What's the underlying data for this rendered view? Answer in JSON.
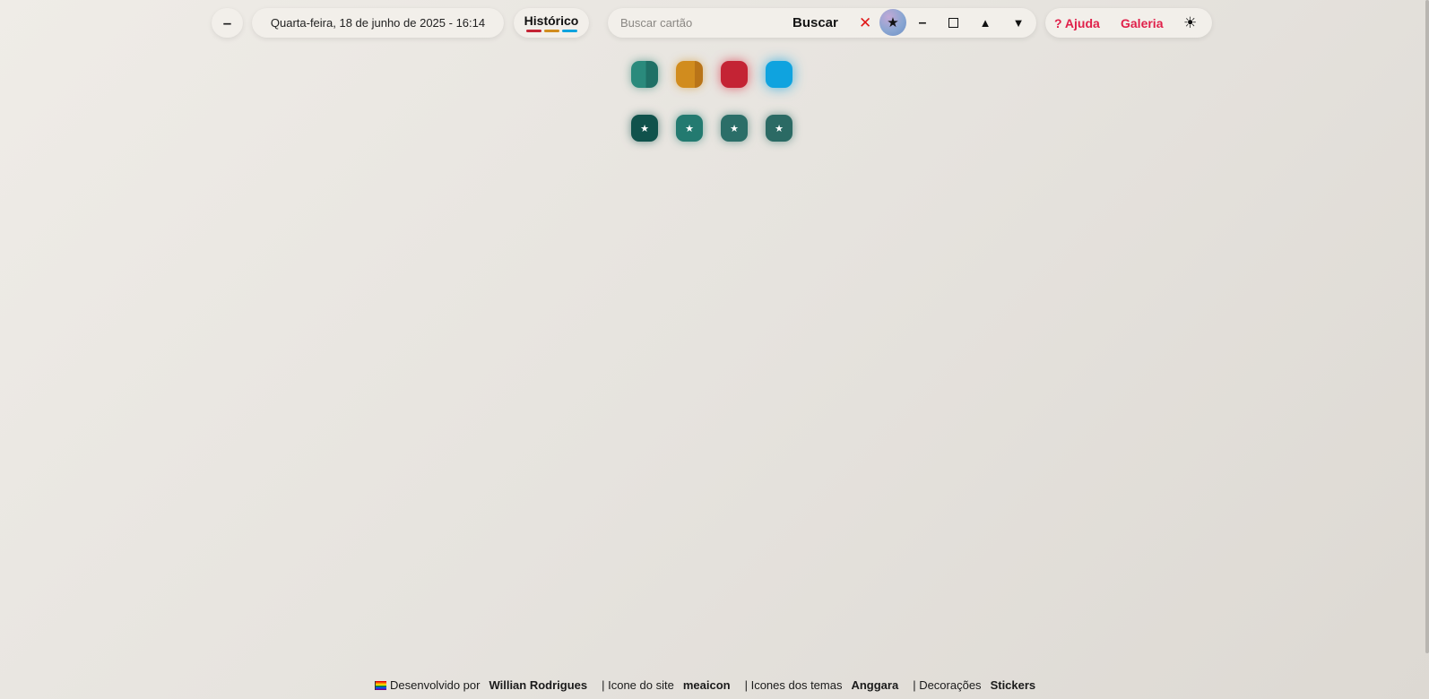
{
  "toolbar": {
    "collapse_label": "–",
    "date_time": "Quarta-feira, 18 de junho de 2025 - 16:14",
    "history_label": "Histórico",
    "history_colors": [
      "#c42334",
      "#d18c1e",
      "#0fa3df"
    ],
    "search": {
      "placeholder": "Buscar cartão",
      "value": "",
      "button_label": "Buscar",
      "clear_label": "✕"
    },
    "star_label": "★",
    "minimize_label": "–",
    "up_label": "▲",
    "down_label": "▼",
    "help_label": "? Ajuda",
    "gallery_label": "Galeria",
    "theme_label": "☀"
  },
  "theme_tiles": [
    {
      "name": "teal",
      "color": "#2a8a7c"
    },
    {
      "name": "amber",
      "color": "#d18c1e"
    },
    {
      "name": "red",
      "color": "#c42334"
    },
    {
      "name": "blue",
      "color": "#0fa3df"
    }
  ],
  "favorite_tiles": {
    "icon": "star-icon",
    "symbol": "★",
    "colors": [
      "#10524c",
      "#237a70",
      "#2b6e68",
      "#2b6a64"
    ]
  },
  "footer": {
    "developed_by_label": "Desenvolvido por",
    "developer": "Willian Rodrigues",
    "site_icon_label": "| Icone do site",
    "site_icon_author": "meaicon",
    "theme_icons_label": "| Icones dos temas",
    "theme_icons_author": "Anggara",
    "decorations_label": "| Decorações",
    "decorations_author": "Stickers"
  }
}
